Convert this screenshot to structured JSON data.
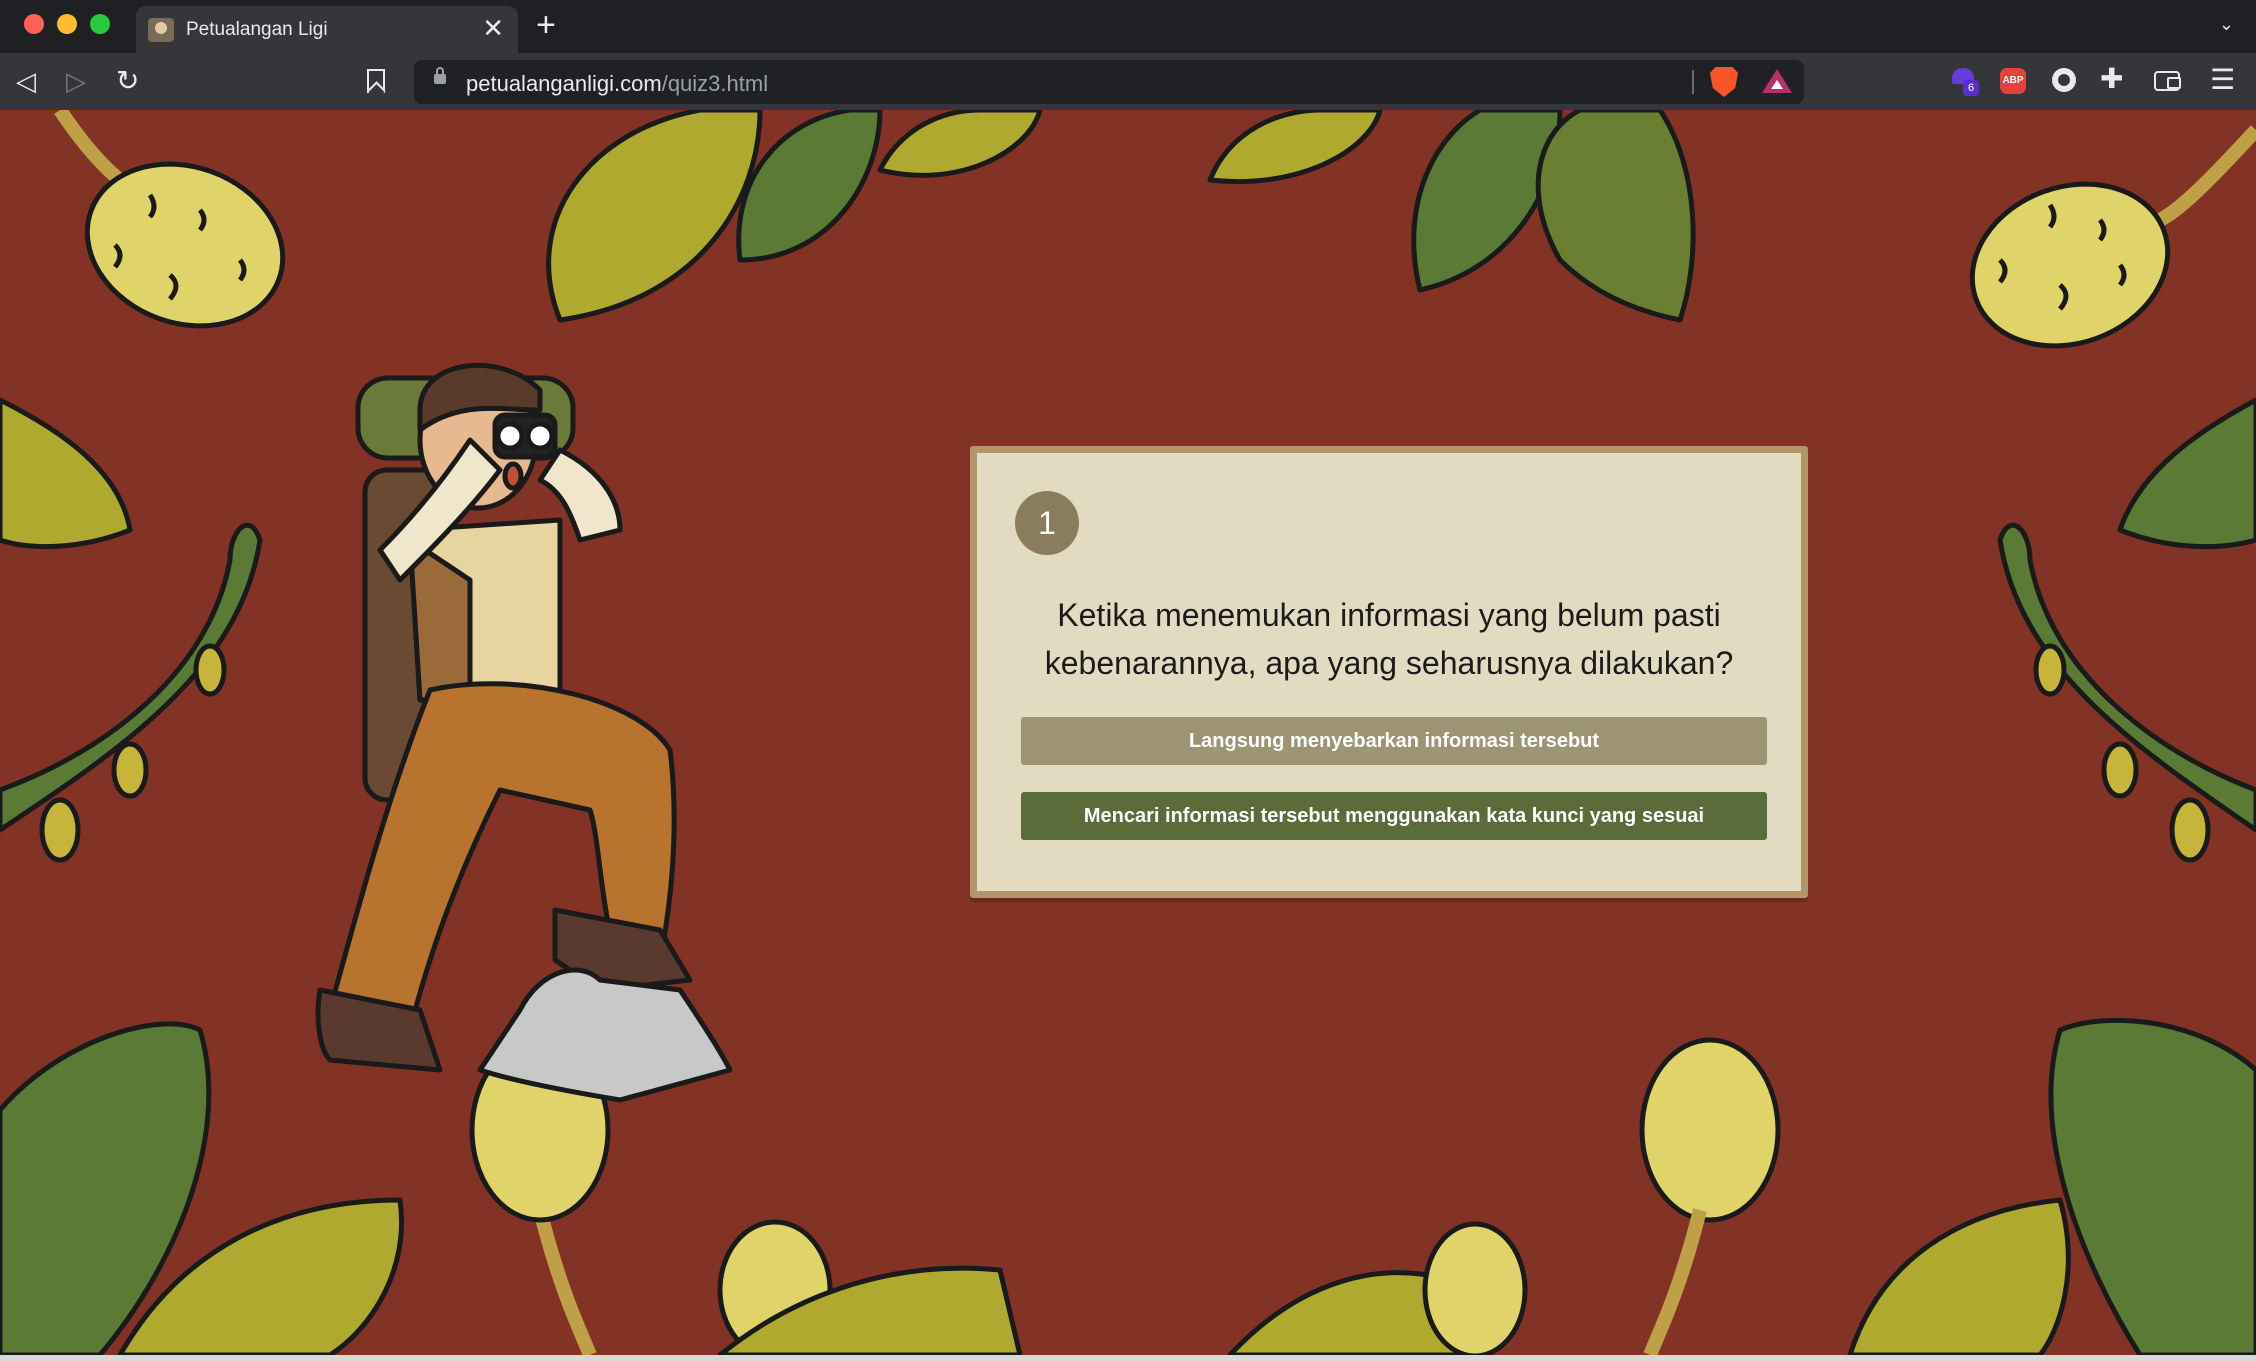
{
  "browser": {
    "tab_title": "Petualangan Ligi",
    "tab_close": "✕",
    "new_tab": "+",
    "url_host": "petualanganligi.com",
    "url_path": "/quiz3.html",
    "extension_badge": "6",
    "adblock_label": "ABP"
  },
  "quiz": {
    "number": "1",
    "question": "Ketika menemukan informasi yang belum pasti kebenarannya, apa yang seharusnya dilakukan?",
    "options": [
      "Langsung menyebarkan informasi tersebut",
      "Mencari informasi tersebut menggunakan kata kunci yang sesuai"
    ]
  },
  "colors": {
    "background": "#833226",
    "card": "#e3dbc1",
    "card_border": "#b49469",
    "option_neutral": "#9d9474",
    "option_green": "#5b6b3a",
    "leaf_dark": "#5a7a35",
    "leaf_light": "#b0a92f"
  }
}
